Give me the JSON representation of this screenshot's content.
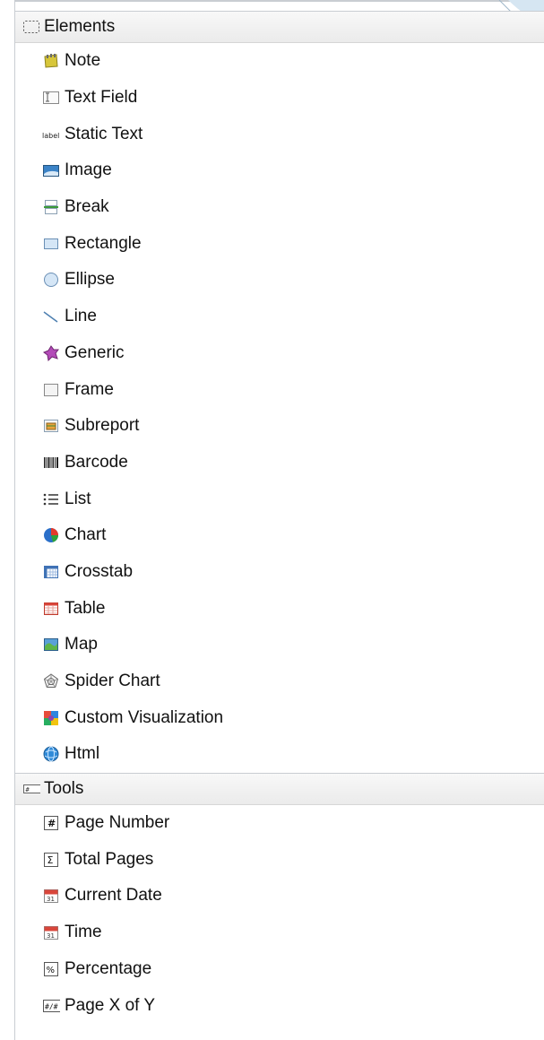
{
  "elements": {
    "header": "Elements",
    "items": [
      {
        "label": "Note",
        "icon": "note-icon"
      },
      {
        "label": "Text Field",
        "icon": "text-field-icon"
      },
      {
        "label": "Static Text",
        "icon": "static-text-icon"
      },
      {
        "label": "Image",
        "icon": "image-icon"
      },
      {
        "label": "Break",
        "icon": "break-icon"
      },
      {
        "label": "Rectangle",
        "icon": "rectangle-icon"
      },
      {
        "label": "Ellipse",
        "icon": "ellipse-icon"
      },
      {
        "label": "Line",
        "icon": "line-icon"
      },
      {
        "label": "Generic",
        "icon": "generic-icon"
      },
      {
        "label": "Frame",
        "icon": "frame-icon"
      },
      {
        "label": "Subreport",
        "icon": "subreport-icon"
      },
      {
        "label": "Barcode",
        "icon": "barcode-icon"
      },
      {
        "label": "List",
        "icon": "list-icon"
      },
      {
        "label": "Chart",
        "icon": "chart-icon"
      },
      {
        "label": "Crosstab",
        "icon": "crosstab-icon"
      },
      {
        "label": "Table",
        "icon": "table-icon"
      },
      {
        "label": "Map",
        "icon": "map-icon"
      },
      {
        "label": "Spider Chart",
        "icon": "spider-chart-icon"
      },
      {
        "label": "Custom Visualization",
        "icon": "custom-visualization-icon"
      },
      {
        "label": "Html",
        "icon": "html-icon"
      }
    ]
  },
  "tools": {
    "header": "Tools",
    "items": [
      {
        "label": "Page Number",
        "icon": "page-number-icon"
      },
      {
        "label": "Total Pages",
        "icon": "total-pages-icon"
      },
      {
        "label": "Current Date",
        "icon": "current-date-icon"
      },
      {
        "label": "Time",
        "icon": "time-icon"
      },
      {
        "label": "Percentage",
        "icon": "percentage-icon"
      },
      {
        "label": "Page X of Y",
        "icon": "page-x-of-y-icon"
      }
    ]
  },
  "icon_text": {
    "static_text": "label",
    "page_number": "#",
    "total_pages": "Σ",
    "calendar_day": "31",
    "percentage": "%",
    "page_x_of_y": "#/#"
  },
  "colors": {
    "header_bg": "#ededed",
    "border": "#c9cdd2",
    "text": "#111111"
  }
}
